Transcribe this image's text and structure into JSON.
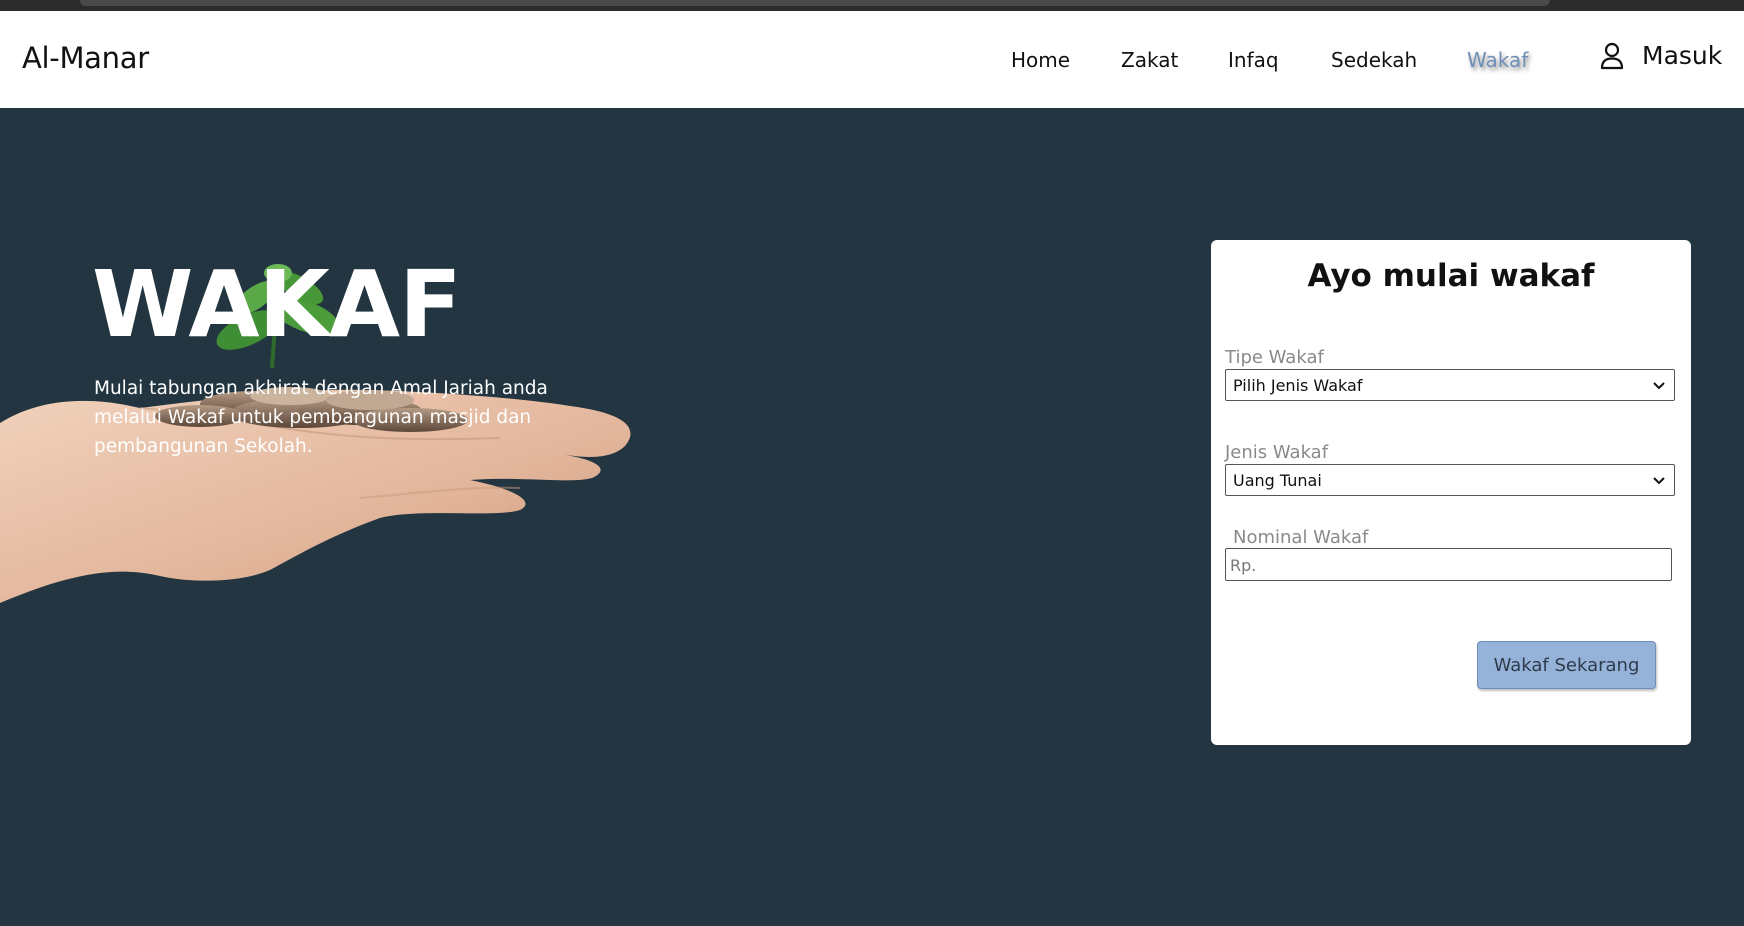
{
  "brand": "Al-Manar",
  "nav": {
    "items": [
      {
        "label": "Home"
      },
      {
        "label": "Zakat"
      },
      {
        "label": "Infaq"
      },
      {
        "label": "Sedekah"
      },
      {
        "label": "Wakaf",
        "active": true
      }
    ],
    "login_label": "Masuk",
    "login_icon": "user-icon"
  },
  "hero": {
    "title": "WAKAF",
    "description": "Mulai tabungan akhirat dengan Amal Jariah anda melalui Wakaf untuk pembangunan masjid dan pembangunan Sekolah."
  },
  "form": {
    "title": "Ayo mulai wakaf",
    "tipe_label": "Tipe Wakaf",
    "tipe_value": "Pilih Jenis Wakaf",
    "jenis_label": "Jenis Wakaf",
    "jenis_value": "Uang Tunai",
    "nominal_label": "Nominal Wakaf",
    "nominal_placeholder": "Rp.",
    "submit_label": "Wakaf Sekarang"
  },
  "colors": {
    "background": "#223540",
    "active_nav": "#6f8fb8",
    "button": "#95b3d9"
  }
}
